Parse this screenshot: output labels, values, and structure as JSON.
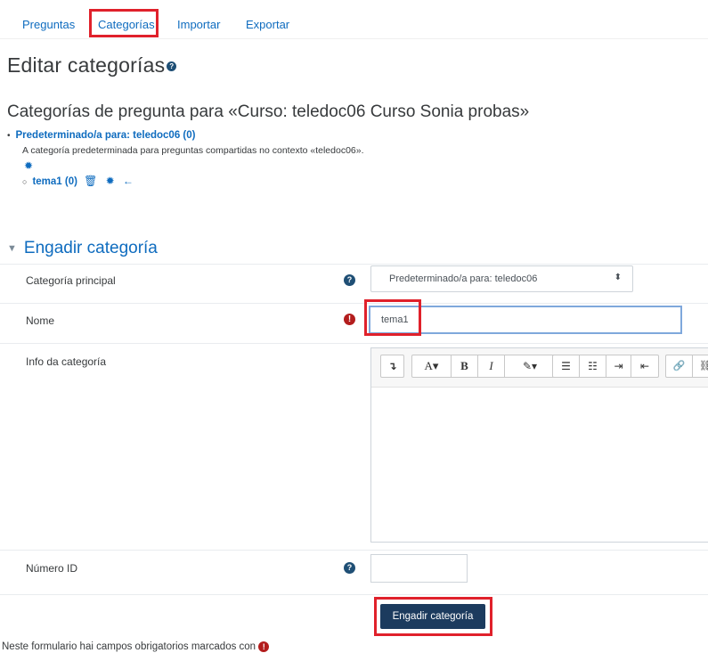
{
  "tabs": [
    {
      "label": "Preguntas"
    },
    {
      "label": "Categorías"
    },
    {
      "label": "Importar"
    },
    {
      "label": "Exportar"
    }
  ],
  "page": {
    "title": "Editar categorías",
    "subtitle": "Categorías de pregunta para «Curso: teledoc06 Curso Sonia probas»"
  },
  "categories": {
    "default": {
      "link": "Predeterminado/a para: teledoc06 (0)",
      "description": "A categoría predeterminada para preguntas compartidas no contexto «teledoc06»."
    },
    "child": {
      "link": "tema1 (0)"
    }
  },
  "form": {
    "section_title": "Engadir categoría",
    "parent": {
      "label": "Categoría principal",
      "selected": "Predeterminado/a para: teledoc06"
    },
    "name": {
      "label": "Nome",
      "value": "tema1"
    },
    "info": {
      "label": "Info da categoría"
    },
    "idnumber": {
      "label": "Número ID",
      "value": ""
    },
    "submit_label": "Engadir categoría",
    "required_note": "Neste formulario hai campos obrigatorios marcados con"
  },
  "editor_toolbar": {
    "groups": [
      [
        "↴"
      ],
      [
        "A▾",
        "B",
        "I",
        "✎▾"
      ],
      [
        "☰",
        "☷",
        "⇥",
        "⇤"
      ],
      [
        "🔗",
        "⛓"
      ]
    ]
  },
  "colors": {
    "link": "#0f6cbf",
    "primary_button": "#1c3b5e",
    "required": "#b31d1d",
    "highlight_box": "#e0212b"
  }
}
